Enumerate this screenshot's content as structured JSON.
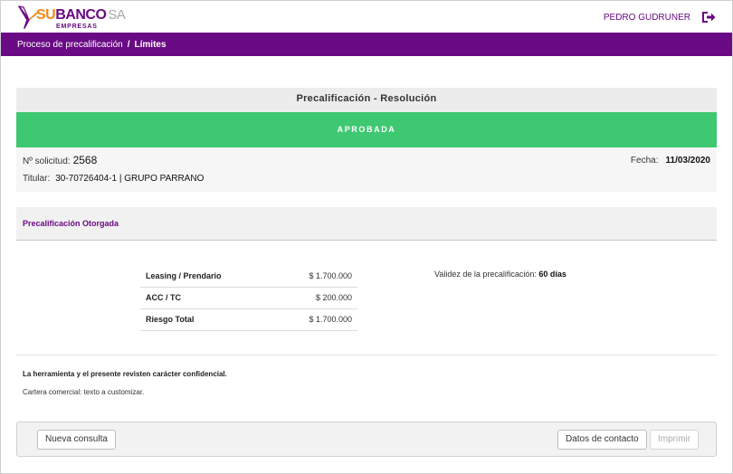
{
  "brand": {
    "su": "SU",
    "banco": "BANCO",
    "sa": "SA",
    "sub": "EMPRESAS"
  },
  "header": {
    "user_name": "PEDRO GUDRUNER",
    "logout_icon": "logout-icon"
  },
  "breadcrumb": {
    "parent": "Proceso de precalificación",
    "separator": "/",
    "current": "Límites"
  },
  "panel": {
    "title": "Precalificación - Resolución",
    "status": "APROBADA"
  },
  "request": {
    "number_label": "Nº solicitud:",
    "number": "2568",
    "date_label": "Fecha:",
    "date": "11/03/2020",
    "holder_label": "Titular:",
    "holder": "30-70726404-1 | GRUPO PARRANO"
  },
  "section": {
    "title": "Precalificación Otorgada"
  },
  "limits": [
    {
      "label": "Leasing / Prendario",
      "amount": "$ 1.700.000"
    },
    {
      "label": "ACC / TC",
      "amount": "$ 200.000"
    },
    {
      "label": "Riesgo Total",
      "amount": "$ 1.700.000"
    }
  ],
  "validity": {
    "label": "Validez de la precalificación:",
    "value": "60 días"
  },
  "notes": {
    "confidential": "La herramienta y el presente revisten carácter confidencial.",
    "cartera": "Cartera comercial: texto a customizar."
  },
  "actions": {
    "new_query": "Nueva consulta",
    "contact": "Datos de contacto",
    "print": "Imprimir"
  },
  "colors": {
    "brand_purple": "#6a0a84",
    "brand_orange": "#f08a1c",
    "approved_green": "#3ec871"
  }
}
